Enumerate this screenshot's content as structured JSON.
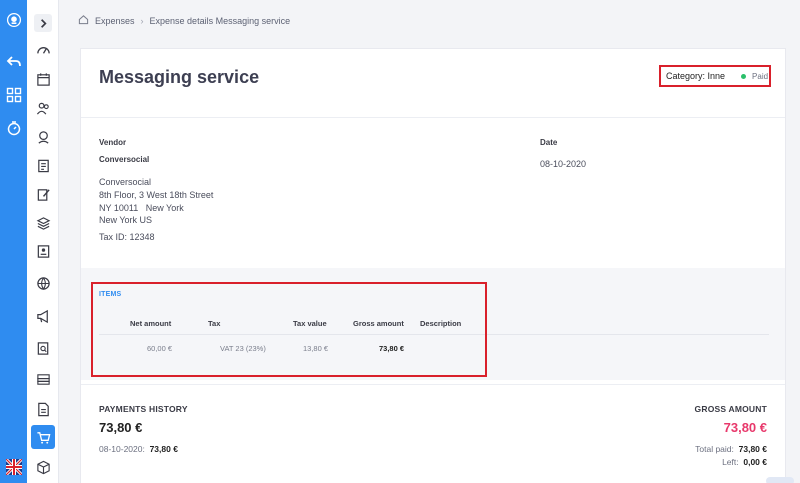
{
  "breadcrumb": {
    "home": "Expenses",
    "current": "Expense details Messaging service"
  },
  "expense": {
    "title": "Messaging service",
    "category_label": "Category: Inne",
    "status": "Paid",
    "status_color": "#2bbf6a",
    "vendor_label": "Vendor",
    "vendor_name": "Conversocial",
    "address_lines": [
      "Conversocial",
      "8th Floor, 3 West 18th Street",
      "NY 10011   New York",
      "New York US"
    ],
    "tax_id": "Tax ID: 12348",
    "date_label": "Date",
    "date": "08-10-2020"
  },
  "items": {
    "heading": "ITEMS",
    "columns": [
      "Net amount",
      "Tax",
      "Tax value",
      "Gross amount",
      "Description"
    ],
    "rows": [
      {
        "net": "60,00 €",
        "tax": "VAT 23 (23%)",
        "tax_value": "13,80 €",
        "gross": "73,80 €",
        "description": ""
      }
    ]
  },
  "payments": {
    "heading": "PAYMENTS HISTORY",
    "total": "73,80 €",
    "entry_date": "08-10-2020:",
    "entry_amount": "73,80 €"
  },
  "gross": {
    "heading": "GROSS AMOUNT",
    "amount": "73,80 €",
    "total_paid_label": "Total paid:",
    "total_paid": "73,80 €",
    "left_label": "Left:",
    "left": "0,00 €"
  },
  "sidebar": {
    "rail_icons": [
      "logo-icon",
      "back-arrow-icon",
      "grid-icon",
      "timer-icon",
      "uk-flag-icon"
    ],
    "nav_icons": [
      "expand-chevron-icon",
      "dashboard-gauge-icon",
      "calendar-icon",
      "users-icon",
      "support-agent-icon",
      "clipboard-icon",
      "edit-note-icon",
      "layers-icon",
      "contact-card-icon",
      "globe-icon",
      "megaphone-icon",
      "search-document-icon",
      "money-stack-icon",
      "document-icon",
      "cart-icon",
      "box-icon"
    ],
    "accent_color": "#2f8cf0"
  }
}
